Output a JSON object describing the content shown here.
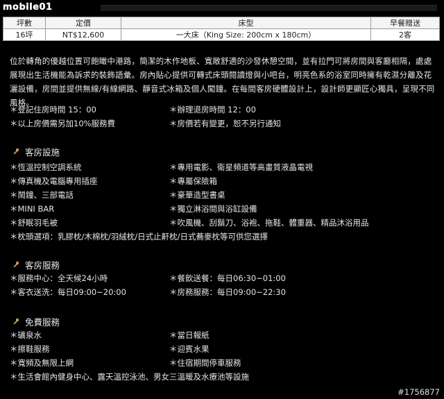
{
  "header": {
    "logo_text": "mobile01"
  },
  "rates_table": {
    "headers": [
      "坪數",
      "定價",
      "床型",
      "早餐贈送"
    ],
    "rows": [
      [
        "16坪",
        "NT$12,600",
        "一大床（King Size: 200cm x 180cm）",
        "2客"
      ]
    ]
  },
  "intro": "位於轉角的優越位置可飽瞰中港路，簡潔的木作地板、寬敞舒適的沙發休憩空間，並有拉門可將房間與客廳相隔，處處展現出生活機能為訴求的裝飾語彙。房內貼心提供可轉式床頭閱讀燈與小吧台，明亮色系的浴室同時擁有乾濕分離及花灑設備，房間並提供無線/有線網路、靜音式冰箱及個人闖鐘。在每間客房硬體設計上，設計師更顯匠心獨具，呈現不同風格。",
  "notes": [
    "＊登記住房時間 15：00",
    "＊辦理退房時間 12：00",
    "＊以上房價需另加10%服務費",
    "＊房價若有變更，恕不另行通知"
  ],
  "sections": [
    {
      "title": "客房設施",
      "items": [
        "＊恆溫控制空調系統",
        "＊專用電影、衛星頻道等高畫質液晶電視",
        "＊傳真機及電腦專用插座",
        "＊專屬保險箱",
        "＊鬧鐘、三部電話",
        "＊豪華造型書桌",
        "＊MINI BAR",
        "＊獨立淋浴間與浴缸設備",
        "＊舒眠羽毛被",
        "＊吹風機、刮鬍刀、浴袍、拖鞋、體重器、精品沐浴用品",
        "＊枕頭選項：乳膠枕/木棉枕/羽絨枕/日式止鼾枕/日式蕎麥枕等可供您選擇"
      ]
    },
    {
      "title": "客房服務",
      "items": [
        "＊服務中心：全天候24小時",
        "＊餐飲送餐：每日06:30~01:00",
        "＊客衣送洗：每日09:00~20:00",
        "＊房務服務：每日09:00~22:30"
      ]
    },
    {
      "title": "免費服務",
      "items": [
        "＊礦泉水",
        "＊當日報紙",
        "＊擦鞋服務",
        "＊迎賓水果",
        "＊寬頻及無限上網",
        "＊住宿期間停車服務",
        "＊生活會館內健身中心、露天溫控泳池、男女三溫暖及水療池等設施"
      ]
    }
  ],
  "watermark": "#1756877"
}
